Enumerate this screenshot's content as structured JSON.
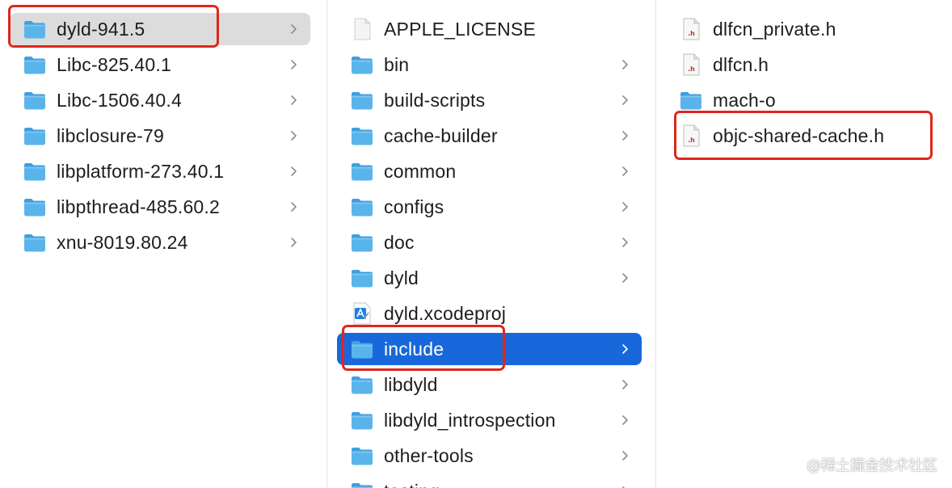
{
  "columns": [
    {
      "items": [
        {
          "label": "dyld-941.5",
          "kind": "folder",
          "chevron": true,
          "state": "selected-inactive"
        },
        {
          "label": "Libc-825.40.1",
          "kind": "folder",
          "chevron": true
        },
        {
          "label": "Libc-1506.40.4",
          "kind": "folder",
          "chevron": true
        },
        {
          "label": "libclosure-79",
          "kind": "folder",
          "chevron": true
        },
        {
          "label": "libplatform-273.40.1",
          "kind": "folder",
          "chevron": true
        },
        {
          "label": "libpthread-485.60.2",
          "kind": "folder",
          "chevron": true
        },
        {
          "label": "xnu-8019.80.24",
          "kind": "folder",
          "chevron": true
        }
      ]
    },
    {
      "items": [
        {
          "label": "APPLE_LICENSE",
          "kind": "document",
          "chevron": false
        },
        {
          "label": "bin",
          "kind": "folder",
          "chevron": true
        },
        {
          "label": "build-scripts",
          "kind": "folder",
          "chevron": true
        },
        {
          "label": "cache-builder",
          "kind": "folder",
          "chevron": true
        },
        {
          "label": "common",
          "kind": "folder",
          "chevron": true
        },
        {
          "label": "configs",
          "kind": "folder",
          "chevron": true
        },
        {
          "label": "doc",
          "kind": "folder",
          "chevron": true
        },
        {
          "label": "dyld",
          "kind": "folder",
          "chevron": true
        },
        {
          "label": "dyld.xcodeproj",
          "kind": "xcodeproj",
          "chevron": false
        },
        {
          "label": "include",
          "kind": "folder",
          "chevron": true,
          "state": "selected-active"
        },
        {
          "label": "libdyld",
          "kind": "folder",
          "chevron": true
        },
        {
          "label": "libdyld_introspection",
          "kind": "folder",
          "chevron": true
        },
        {
          "label": "other-tools",
          "kind": "folder",
          "chevron": true
        },
        {
          "label": "testing",
          "kind": "folder",
          "chevron": true
        }
      ]
    },
    {
      "items": [
        {
          "label": "dlfcn_private.h",
          "kind": "header-file",
          "chevron": false
        },
        {
          "label": "dlfcn.h",
          "kind": "header-file",
          "chevron": false
        },
        {
          "label": "mach-o",
          "kind": "folder",
          "chevron": false
        },
        {
          "label": "objc-shared-cache.h",
          "kind": "header-file",
          "chevron": false
        }
      ]
    }
  ],
  "header_file_badge": ".h",
  "colors": {
    "folder": "#5ab4ec",
    "selection_active": "#1868db",
    "selection_inactive": "#dcdcdc",
    "annotation": "#e0261b"
  },
  "watermark": "@稀土掘金技术社区"
}
